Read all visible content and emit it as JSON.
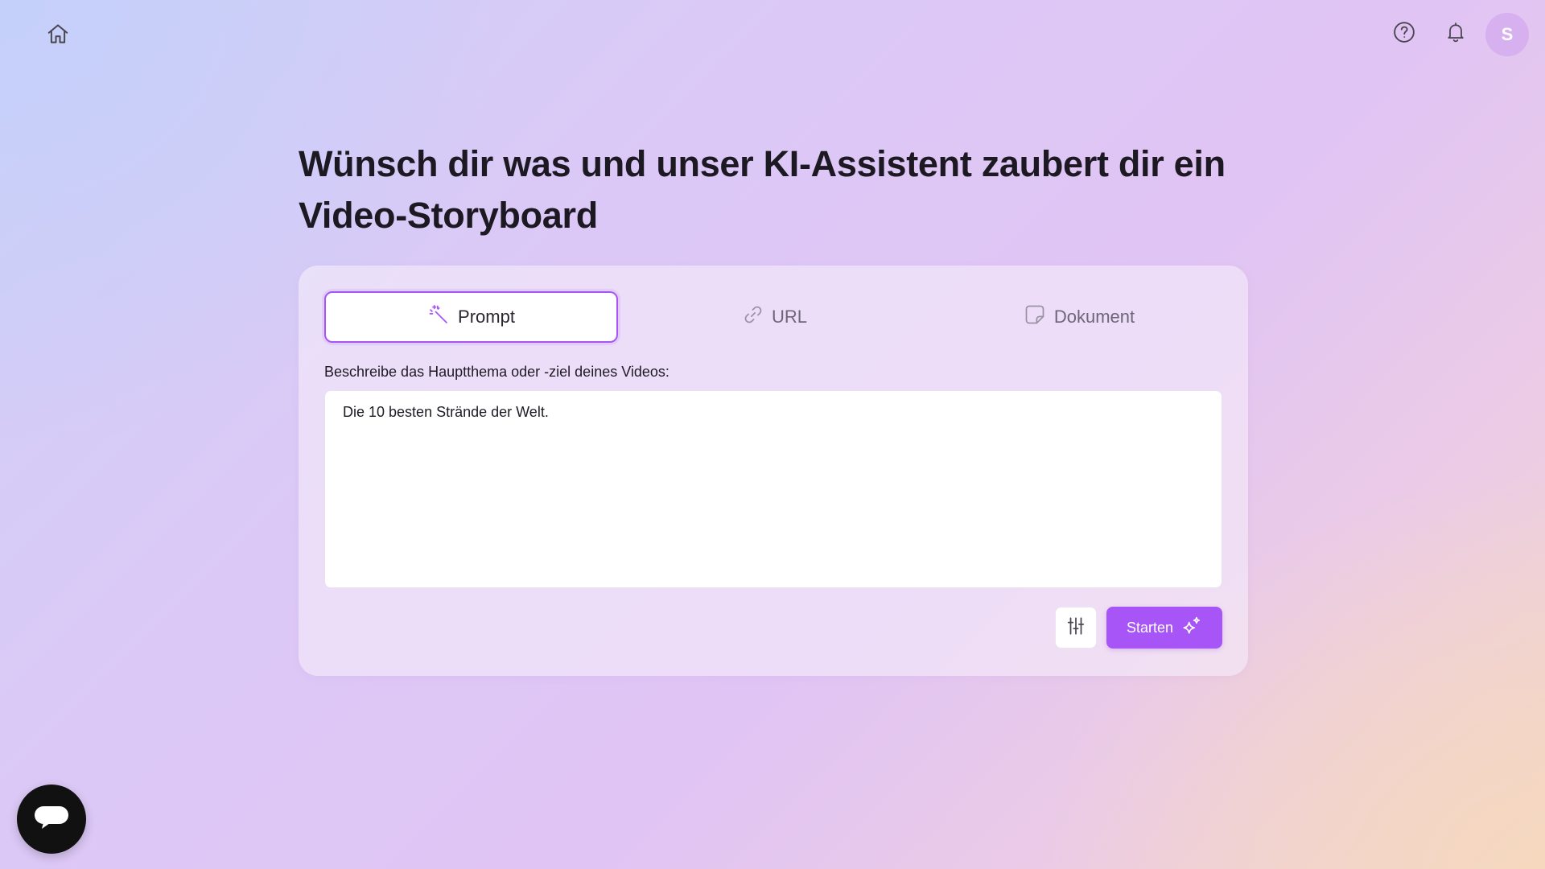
{
  "header": {
    "home_icon": "home-icon",
    "help_icon": "help-circle-icon",
    "bell_icon": "bell-icon",
    "avatar_initial": "S"
  },
  "main": {
    "title_line1": "Wünsch dir was und unser KI-Assistent zaubert dir ein",
    "title_line2": "Video-Storyboard",
    "tabs": [
      {
        "label": "Prompt",
        "icon": "magic-wand-icon",
        "active": true
      },
      {
        "label": "URL",
        "icon": "link-icon",
        "active": false
      },
      {
        "label": "Dokument",
        "icon": "document-icon",
        "active": false
      }
    ],
    "field_label": "Beschreibe das Hauptthema oder -ziel deines Videos:",
    "input_value": "Die 10 besten Strände der Welt.",
    "settings_icon": "sliders-icon",
    "start_label": "Starten",
    "start_icon": "sparkles-icon"
  },
  "chat": {
    "icon": "chat-bubble-icon"
  },
  "colors": {
    "accent": "#a855f7",
    "avatar_bg": "#d7b0ef",
    "title_text": "#1d1922"
  }
}
